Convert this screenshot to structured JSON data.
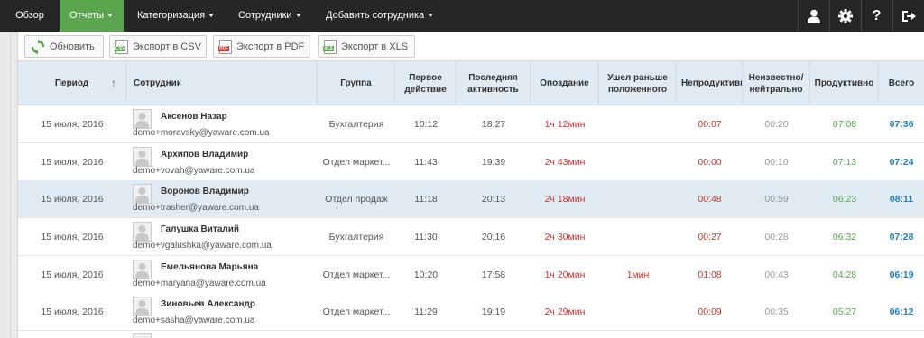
{
  "nav": {
    "items": [
      {
        "label": "Обзор",
        "dropdown": false,
        "active": false
      },
      {
        "label": "Отчеты",
        "dropdown": true,
        "active": true
      },
      {
        "label": "Категоризация",
        "dropdown": true,
        "active": false
      },
      {
        "label": "Сотрудники",
        "dropdown": true,
        "active": false
      },
      {
        "label": "Добавить сотрудника",
        "dropdown": true,
        "active": false
      }
    ],
    "right_icons": [
      "user-icon",
      "gear-icon",
      "help-icon",
      "logout-icon"
    ]
  },
  "toolbar": {
    "refresh_label": "Обновить",
    "csv_label": "Экспорт в CSV",
    "pdf_label": "Экспорт в PDF",
    "xls_label": "Экспорт в XLS",
    "csv_tag": "CSV",
    "pdf_tag": "PDF",
    "xls_tag": "XLS"
  },
  "table": {
    "columns": {
      "period": "Период",
      "employee": "Сотрудник",
      "group": "Группа",
      "first_action": "Первое действие",
      "last_activity": "Последняя активность",
      "late": "Опоздание",
      "left_early": "Ушел раньше положенного",
      "unproductive": "Непродуктивно",
      "unknown": "Неизвестно/ нейтрально",
      "productive": "Продуктивно",
      "total": "Всего"
    },
    "sort_indicator": "↑",
    "rows": [
      {
        "period": "15 июля, 2016",
        "name": "Аксенов Назар",
        "email": "demo+moravsky@yaware.com.ua",
        "group": "Бухгалтерия",
        "first": "10:12",
        "last": "18:27",
        "late": "1ч 12мин",
        "early": "",
        "unproductive": "00:07",
        "unknown": "00:20",
        "productive": "07:08",
        "total": "07:36"
      },
      {
        "period": "15 июля, 2016",
        "name": "Архипов Владимир",
        "email": "demo+vovah@yaware.com.ua",
        "group": "Отдел маркет...",
        "first": "11:43",
        "last": "19:39",
        "late": "2ч 43мин",
        "early": "",
        "unproductive": "00:00",
        "unknown": "00:10",
        "productive": "07:13",
        "total": "07:24"
      },
      {
        "period": "15 июля, 2016",
        "name": "Воронов Владимир",
        "email": "demo+trasher@yaware.com.ua",
        "group": "Отдел продаж",
        "first": "11:18",
        "last": "20:13",
        "late": "2ч 18мин",
        "early": "",
        "unproductive": "00:48",
        "unknown": "00:59",
        "productive": "06:23",
        "total": "08:11"
      },
      {
        "period": "15 июля, 2016",
        "name": "Галушка Виталий",
        "email": "demo+vgalushka@yaware.com.ua",
        "group": "Бухгалтерия",
        "first": "11:30",
        "last": "20:16",
        "late": "2ч 30мин",
        "early": "",
        "unproductive": "00:27",
        "unknown": "00:28",
        "productive": "06:32",
        "total": "07:28"
      },
      {
        "period": "15 июля, 2016",
        "name": "Емельянова Марьяна",
        "email": "demo+maryana@yaware.com.ua",
        "group": "Отдел маркет...",
        "first": "10:20",
        "last": "17:58",
        "late": "1ч 20мин",
        "early": "1мин",
        "unproductive": "01:08",
        "unknown": "00:43",
        "productive": "04:28",
        "total": "06:19"
      },
      {
        "period": "15 июля, 2016",
        "name": "Зиновьев Александр",
        "email": "demo+sasha@yaware.com.ua",
        "group": "Отдел маркет...",
        "first": "11:29",
        "last": "19:19",
        "late": "2ч 29мин",
        "early": "",
        "unproductive": "00:09",
        "unknown": "00:35",
        "productive": "05:27",
        "total": "06:12"
      }
    ]
  },
  "colors": {
    "nav_bg": "#262626",
    "nav_active": "#5aa54e",
    "header_bg": "#dfeaf3",
    "late": "#d9302c",
    "productive": "#5aa54e",
    "total": "#1f7fbf"
  }
}
